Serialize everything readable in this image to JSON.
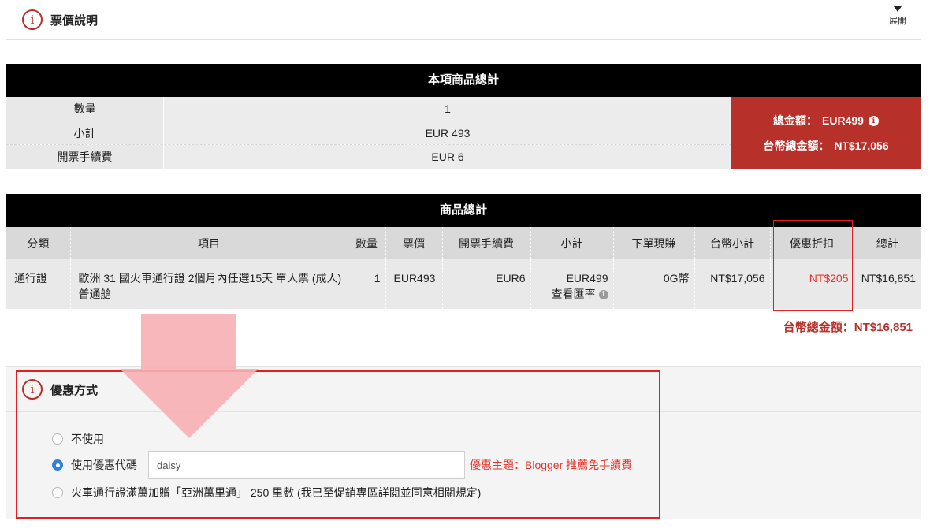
{
  "header": {
    "info_glyph": "i",
    "title": "票價說明",
    "expand_label": "展開"
  },
  "summary_item": {
    "title": "本項商品總計",
    "rows": [
      {
        "label": "數量",
        "value": "1"
      },
      {
        "label": "小計",
        "value": "EUR 493"
      },
      {
        "label": "開票手續費",
        "value": "EUR 6"
      }
    ],
    "total_label": "總金額：",
    "total_value": "EUR499",
    "twd_total_label": "台幣總金額：",
    "twd_total_value": "NT$17,056",
    "info_glyph": "i"
  },
  "summary_goods": {
    "title": "商品總計",
    "columns": [
      "分類",
      "項目",
      "數量",
      "票價",
      "開票手續費",
      "小計",
      "下單現賺",
      "台幣小計",
      "優惠折扣",
      "總計"
    ],
    "row": {
      "category": "通行證",
      "item": "歐洲 31 國火車通行證 2個月內任選15天 單人票 (成人) 普通艙",
      "qty": "1",
      "price": "EUR493",
      "fee": "EUR6",
      "subtotal": "EUR499",
      "exchange_link": "查看匯率",
      "cashback": "0G幣",
      "twd_subtotal": "NT$17,056",
      "discount": "NT$205",
      "total": "NT$16,851"
    },
    "after_total_label": "台幣總金額：",
    "after_total_value": "NT$16,851"
  },
  "promo": {
    "info_glyph": "i",
    "title": "優惠方式",
    "options": [
      {
        "label": "不使用",
        "checked": false
      },
      {
        "label": "使用優惠代碼",
        "checked": true
      },
      {
        "label": "火車通行證滿萬加贈「亞洲萬里通」 250 里數 (我已至促銷專區詳閱並同意相關規定)",
        "checked": false
      }
    ],
    "code_value": "daisy",
    "theme_text": "優惠主題：Blogger 推薦免手續費"
  },
  "colors": {
    "brand_red": "#b8302a",
    "highlight_red": "#e02020",
    "radio_blue": "#2f80d8",
    "arrow_pink": "#f7b0b4"
  },
  "icons": [
    "info-icon",
    "caret-down-icon",
    "radio-icon",
    "arrow-down-icon"
  ]
}
